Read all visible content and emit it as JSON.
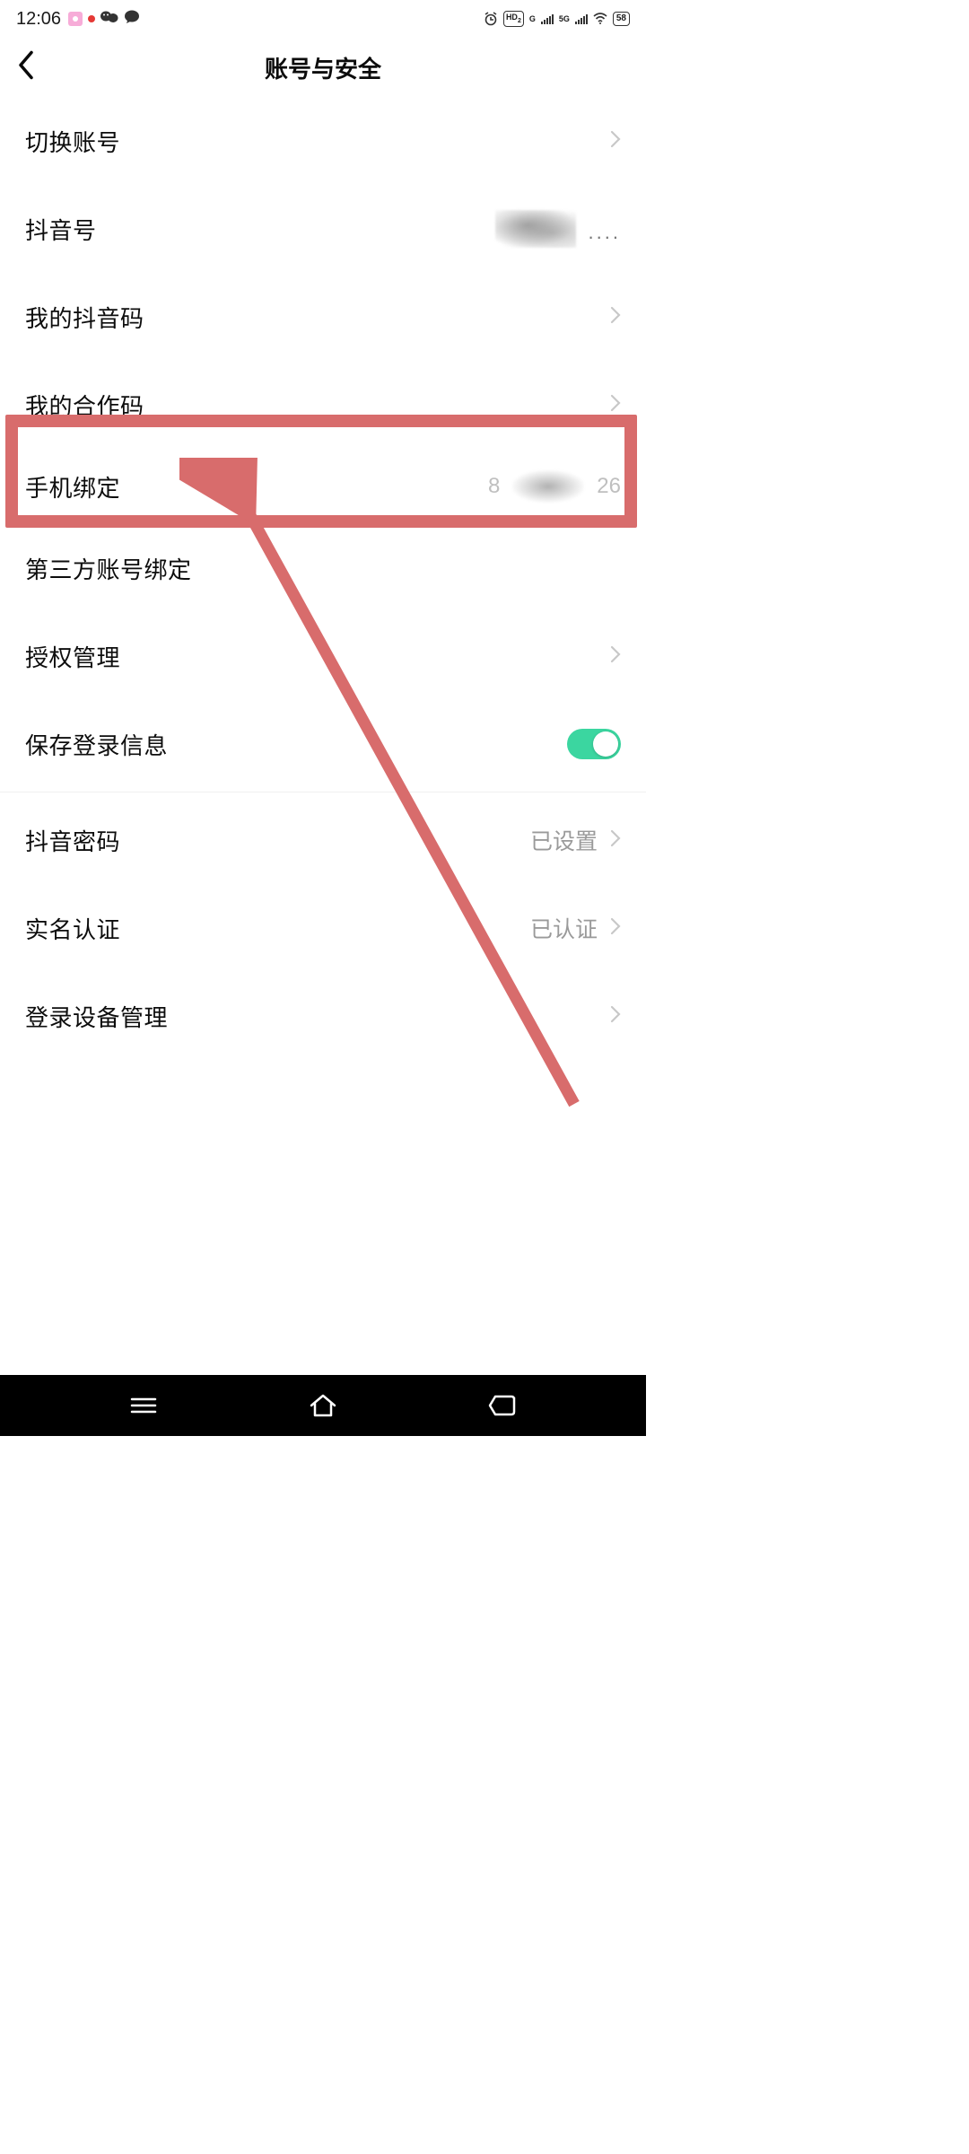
{
  "status_bar": {
    "time": "12:06",
    "battery": "58"
  },
  "header": {
    "title": "账号与安全"
  },
  "rows": {
    "switch_account": {
      "label": "切换账号"
    },
    "douyin_id": {
      "label": "抖音号"
    },
    "my_qr": {
      "label": "我的抖音码"
    },
    "coop_code": {
      "label": "我的合作码"
    },
    "phone_bind": {
      "label": "手机绑定",
      "value_prefix": "8",
      "value_suffix": "26"
    },
    "third_party": {
      "label": "第三方账号绑定"
    },
    "auth_mgmt": {
      "label": "授权管理"
    },
    "save_login": {
      "label": "保存登录信息"
    },
    "password": {
      "label": "抖音密码",
      "value": "已设置"
    },
    "realname": {
      "label": "实名认证",
      "value": "已认证"
    },
    "devices": {
      "label": "登录设备管理"
    }
  }
}
